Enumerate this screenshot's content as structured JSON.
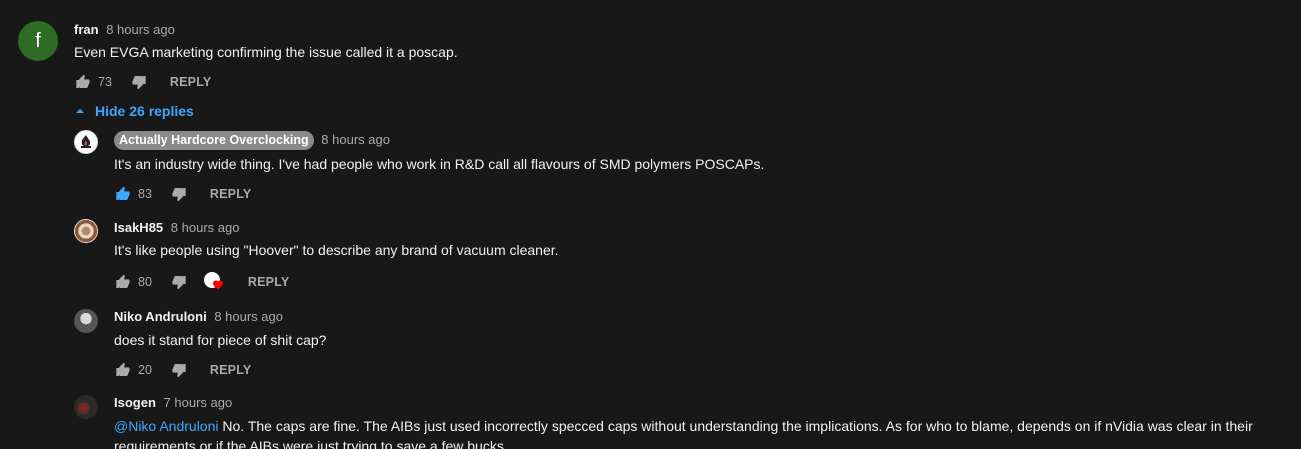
{
  "comment": {
    "author": "fran",
    "time": "8 hours ago",
    "text": "Even EVGA marketing confirming the issue called it a poscap.",
    "avatar_letter": "f",
    "avatar_color": "#2e6b25",
    "likes": "73",
    "reply_label": "REPLY"
  },
  "replies_toggle": {
    "label": "Hide 26 replies",
    "icon": "chevron-up-icon"
  },
  "replies": [
    {
      "author": "Actually Hardcore Overclocking",
      "time": "8 hours ago",
      "text": "It's an industry wide thing. I've had people who work in R&D call all flavours of SMD polymers POSCAPs.",
      "likes": "83",
      "reply_label": "REPLY"
    },
    {
      "author": "IsakH85",
      "time": "8 hours ago",
      "text": "It's like people using \"Hoover\" to describe any brand of vacuum cleaner.",
      "likes": "80",
      "reply_label": "REPLY"
    },
    {
      "author": "Niko Andruloni",
      "time": "8 hours ago",
      "text": "does it stand for piece of shit cap?",
      "likes": "20",
      "reply_label": "REPLY"
    },
    {
      "author": "Isogen",
      "time": "7 hours ago",
      "mention": "@Niko Andruloni",
      "text_line1": " No. The caps are fine. The AIBs just used incorrectly specced caps without understanding the implications. As for who to blame, depends on if nVidia was clear in their",
      "text_line2": "requirements or if the AIBs were just trying to save a few bucks."
    }
  ],
  "colors": {
    "background": "#181818",
    "link": "#3ea6ff",
    "muted": "#aaaaaa",
    "heart": "#ff0000"
  }
}
